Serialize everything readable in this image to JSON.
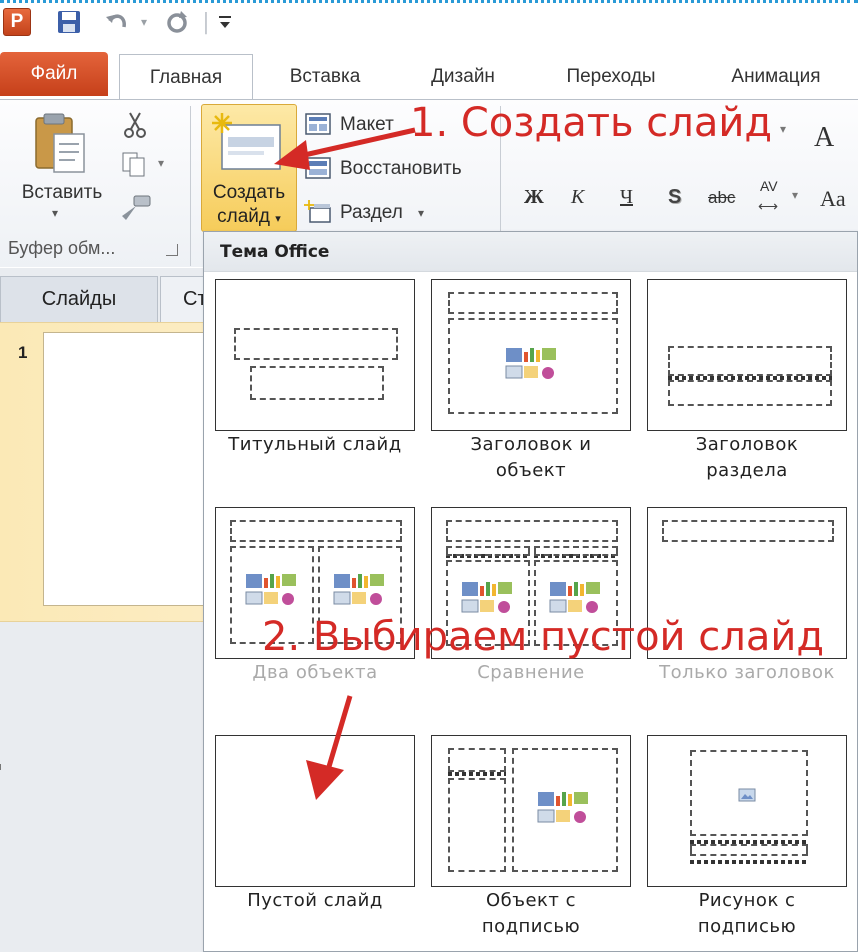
{
  "app": {
    "logo_letter": "P"
  },
  "qat": {
    "separator": "|"
  },
  "tabs": {
    "file": "Файл",
    "home": "Главная",
    "insert": "Вставка",
    "design": "Дизайн",
    "transitions": "Переходы",
    "animation": "Анимация"
  },
  "clipboard": {
    "paste_label": "Вставить",
    "group_label": "Буфер обм...",
    "dropdown_glyph": "▾"
  },
  "slides_group": {
    "new_slide_line1": "Создать",
    "new_slide_line2": "слайд",
    "layout": "Макет",
    "reset": "Восстановить",
    "section": "Раздел"
  },
  "font_group": {
    "bold": "Ж",
    "italic": "К",
    "underline": "Ч",
    "shadow": "S",
    "strike": "abc",
    "spacing": "AV",
    "grow": "A",
    "case": "Aa"
  },
  "left_pane": {
    "tab_slides": "Слайды",
    "tab_outline": "Ст",
    "slide_number": "1"
  },
  "gallery": {
    "header": "Тема Office",
    "layouts": [
      {
        "line1": "Титульный слайд",
        "line2": ""
      },
      {
        "line1": "Заголовок и",
        "line2": "объект"
      },
      {
        "line1": "Заголовок",
        "line2": "раздела"
      },
      {
        "line1": "Два объекта",
        "line2": ""
      },
      {
        "line1": "Сравнение",
        "line2": ""
      },
      {
        "line1": "Только заголовок",
        "line2": ""
      },
      {
        "line1": "Пустой слайд",
        "line2": ""
      },
      {
        "line1": "Объект с",
        "line2": "подписью"
      },
      {
        "line1": "Рисунок с",
        "line2": "подписью"
      }
    ]
  },
  "annotations": {
    "step1": "1. Создать слайд",
    "step2": "2. Выбираем пустой слайд",
    "color": "#d42a26"
  }
}
